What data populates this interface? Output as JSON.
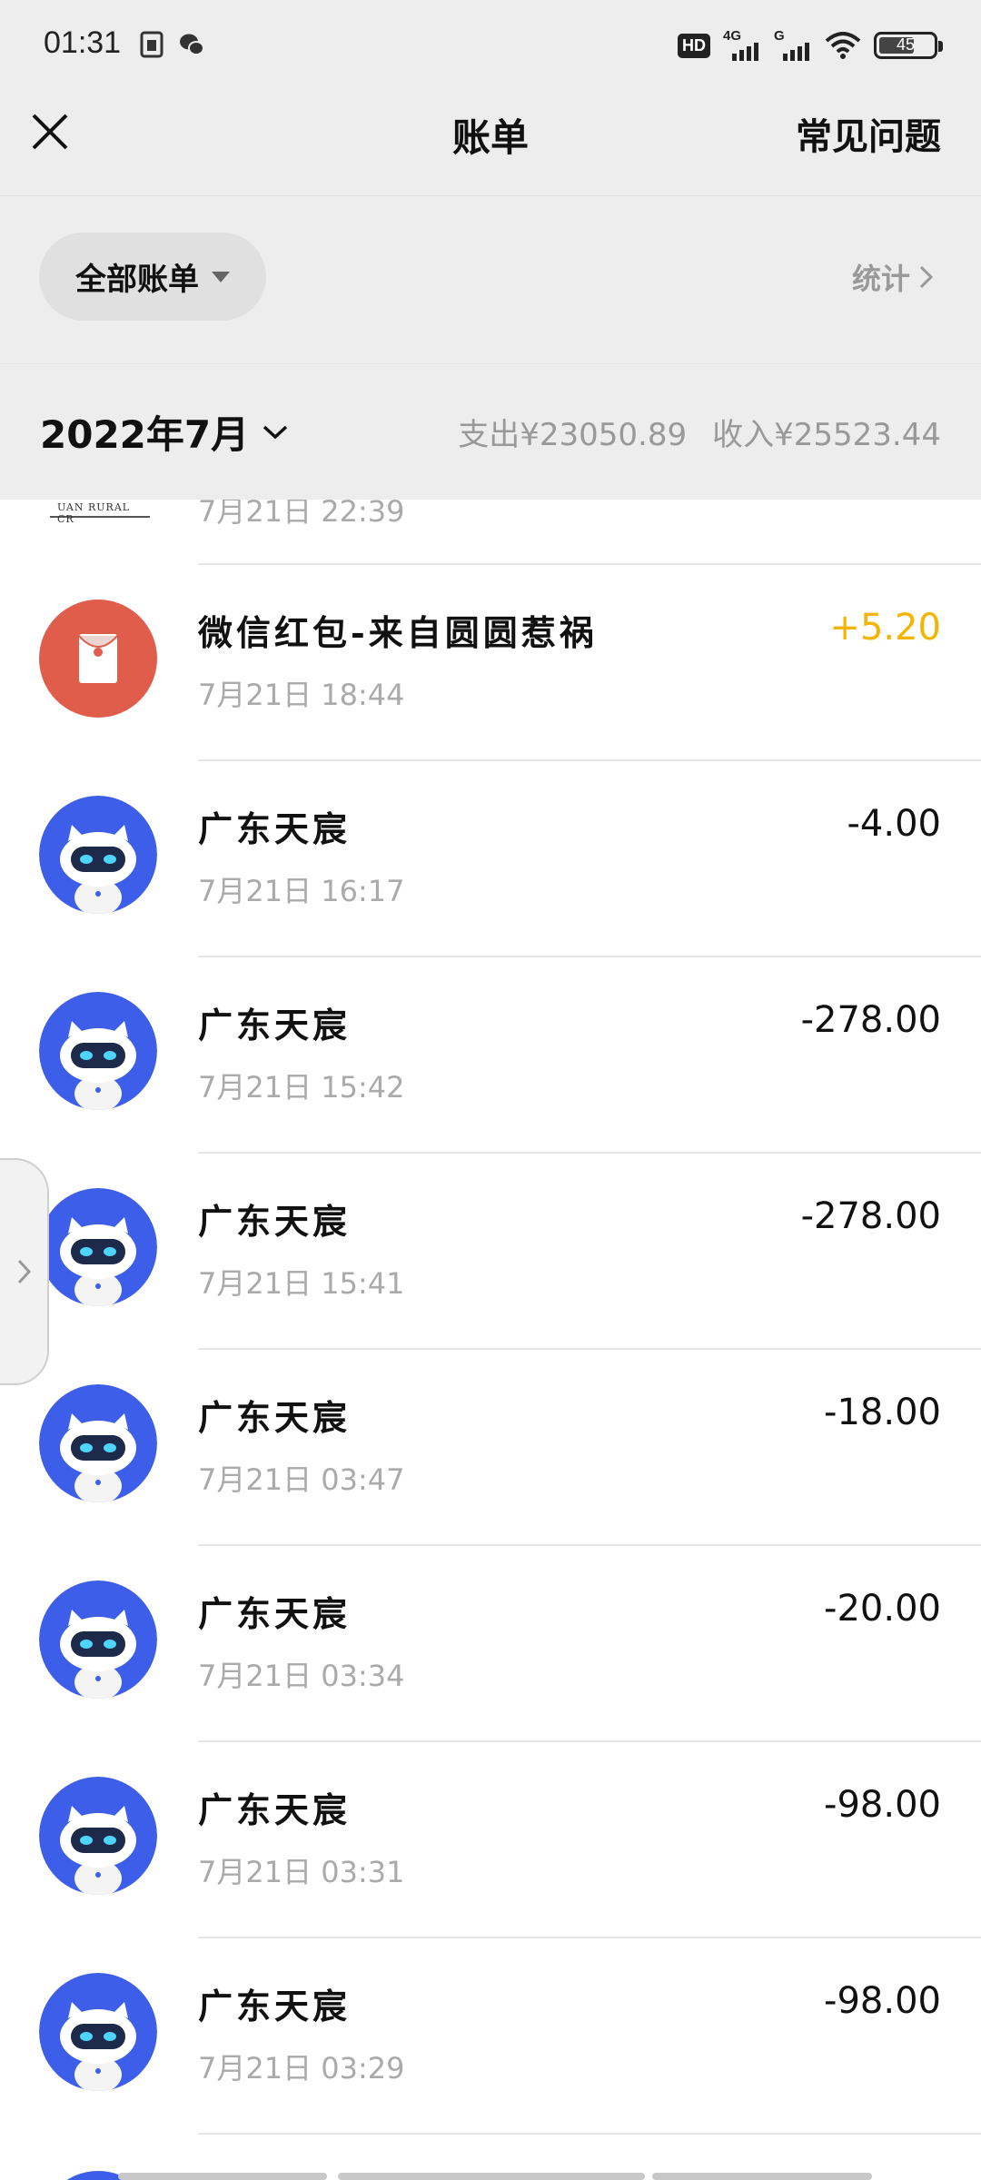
{
  "status_bar": {
    "time": "01:31",
    "hd": "HD",
    "signal1_label": "4G",
    "signal2_label": "G",
    "battery": "45",
    "icons": [
      "sim-icon",
      "wechat-icon",
      "wifi-icon",
      "battery-icon"
    ]
  },
  "nav": {
    "title": "账单",
    "faq": "常见问题"
  },
  "filter": {
    "label": "全部账单",
    "stats": "统计"
  },
  "month": {
    "label": "2022年7月",
    "expense": "支出¥23050.89",
    "income": "收入¥25523.44"
  },
  "partial": {
    "logo_text": "UAN RURAL CR",
    "date": "7月21日 22:39"
  },
  "transactions": [
    {
      "name": "微信红包-来自圆圆惹祸",
      "time": "7月21日 18:44",
      "amount": "+5.20",
      "type": "income",
      "icon": "red-packet-icon"
    },
    {
      "name": "广东天宸",
      "time": "7月21日 16:17",
      "amount": "-4.00",
      "type": "expense",
      "icon": "robot-avatar-icon"
    },
    {
      "name": "广东天宸",
      "time": "7月21日 15:42",
      "amount": "-278.00",
      "type": "expense",
      "icon": "robot-avatar-icon"
    },
    {
      "name": "广东天宸",
      "time": "7月21日 15:41",
      "amount": "-278.00",
      "type": "expense",
      "icon": "robot-avatar-icon"
    },
    {
      "name": "广东天宸",
      "time": "7月21日 03:47",
      "amount": "-18.00",
      "type": "expense",
      "icon": "robot-avatar-icon"
    },
    {
      "name": "广东天宸",
      "time": "7月21日 03:34",
      "amount": "-20.00",
      "type": "expense",
      "icon": "robot-avatar-icon"
    },
    {
      "name": "广东天宸",
      "time": "7月21日 03:31",
      "amount": "-98.00",
      "type": "expense",
      "icon": "robot-avatar-icon"
    },
    {
      "name": "广东天宸",
      "time": "7月21日 03:29",
      "amount": "-98.00",
      "type": "expense",
      "icon": "robot-avatar-icon"
    }
  ],
  "colors": {
    "income": "#f4b400",
    "expense": "#111111",
    "red_packet": "#e05d4b",
    "robot_bg": "#3d5ee8",
    "header_bg": "#ededed"
  }
}
